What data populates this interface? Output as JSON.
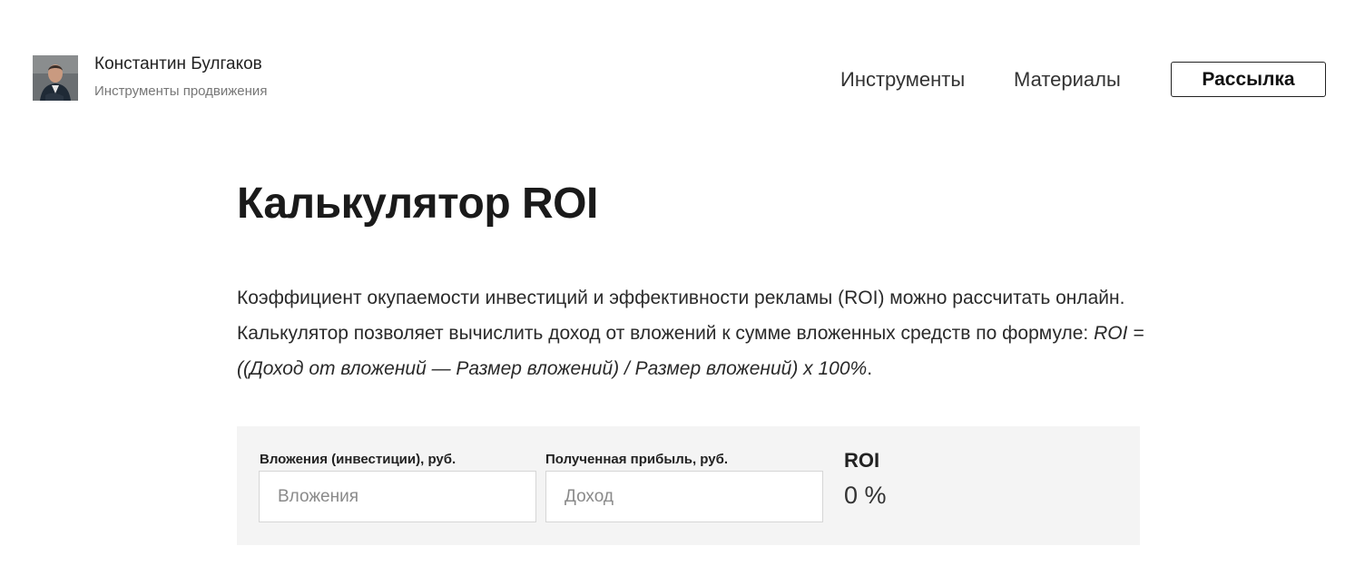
{
  "header": {
    "author_name": "Константин Булгаков",
    "author_subtitle": "Инструменты продвижения",
    "nav": {
      "tools": "Инструменты",
      "materials": "Материалы",
      "newsletter": "Рассылка"
    }
  },
  "main": {
    "title": "Калькулятор ROI",
    "intro_text": "Коэффициент окупаемости инвестиций и эффективности рекламы (ROI) можно рассчитать онлайн. Калькулятор позволяет вычислить доход от вложений к сумме вложенных средств по формуле: ",
    "intro_formula": "ROI = ((Доход от вложений — Размер вложений) / Размер вложений) х 100%",
    "intro_end": "."
  },
  "calculator": {
    "investment": {
      "label": "Вложения (инвестиции), руб.",
      "placeholder": "Вложения",
      "value": ""
    },
    "profit": {
      "label": "Полученная прибыль, руб.",
      "placeholder": "Доход",
      "value": ""
    },
    "roi_label": "ROI",
    "roi_value": "0 %"
  },
  "colors": {
    "calculator_background": "#f4f4f4",
    "text": "#222222",
    "muted_text": "#777777"
  },
  "icons": {
    "avatar": "author-photo"
  }
}
